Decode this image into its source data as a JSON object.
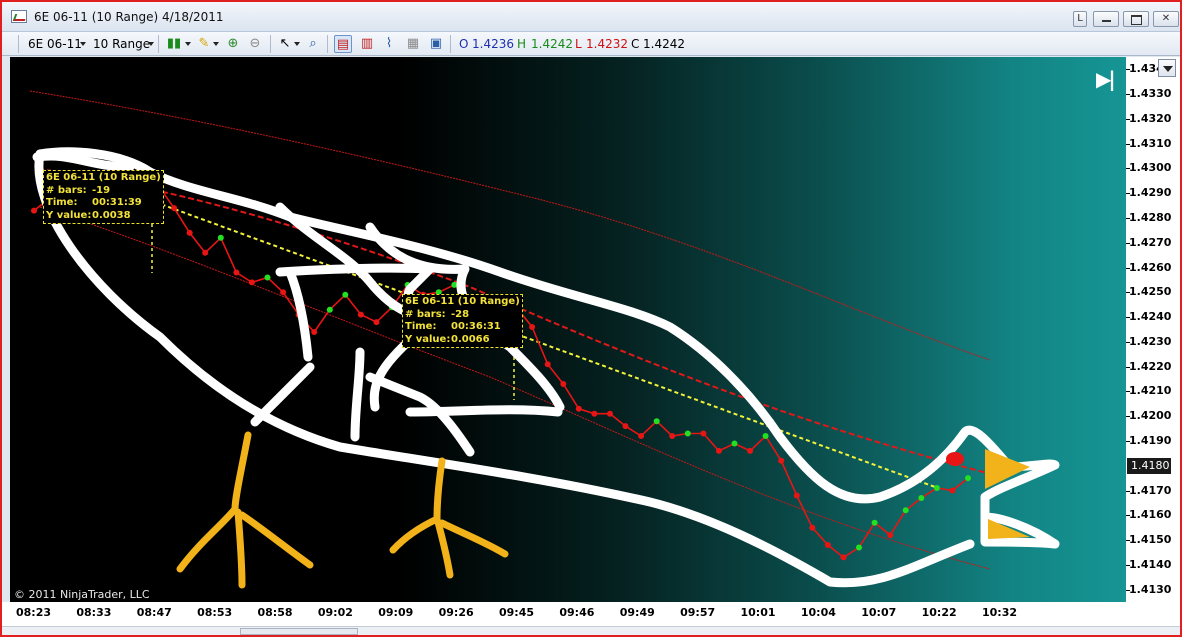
{
  "window": {
    "title": "6E 06-11 (10 Range)  4/18/2011",
    "link_button_label": "L"
  },
  "toolbar": {
    "instrument": "6E 06-11",
    "interval": "10 Range",
    "ohlc": {
      "o_label": "O",
      "o_value": "1.4236",
      "h_label": "H",
      "h_value": "1.4242",
      "l_label": "L",
      "l_value": "1.4232",
      "c_label": "C",
      "c_value": "1.4242"
    },
    "colors": {
      "open": "#1d2fb0",
      "high": "#1a8a1a",
      "low": "#d01010",
      "close": "#000000"
    }
  },
  "price_axis": {
    "ticks": [
      "1.4340",
      "1.4330",
      "1.4320",
      "1.4310",
      "1.4300",
      "1.4290",
      "1.4280",
      "1.4270",
      "1.4260",
      "1.4250",
      "1.4240",
      "1.4230",
      "1.4220",
      "1.4210",
      "1.4200",
      "1.4190",
      "1.4170",
      "1.4160",
      "1.4150",
      "1.4140",
      "1.4130"
    ],
    "last_price": "1.4180"
  },
  "time_axis": {
    "ticks": [
      "08:23",
      "08:33",
      "08:47",
      "08:53",
      "08:58",
      "09:02",
      "09:09",
      "09:26",
      "09:45",
      "09:46",
      "09:49",
      "09:57",
      "10:01",
      "10:04",
      "10:07",
      "10:22",
      "10:32"
    ]
  },
  "chart": {
    "copyright": "© 2011 NinjaTrader, LLC",
    "goto_end_glyph": "▶|",
    "colors": {
      "bar_line": "#e81515",
      "up_dot": "#22e022",
      "down_dot": "#e81515",
      "measure_line": "#f2f23a",
      "doodle_white": "#ffffff",
      "doodle_feet": "#f2b21a",
      "doodle_eye": "#e81515"
    }
  },
  "chart_data": {
    "type": "line",
    "instrument": "6E 06-11 (10 Range)",
    "closes": [
      1.4283,
      1.4288,
      1.4293,
      1.429,
      1.4286,
      1.4292,
      1.4297,
      1.4301,
      1.4293,
      1.4284,
      1.4274,
      1.4266,
      1.4272,
      1.4258,
      1.4254,
      1.4256,
      1.425,
      1.4241,
      1.4234,
      1.4243,
      1.4249,
      1.4241,
      1.4238,
      1.4244,
      1.4253,
      1.4249,
      1.425,
      1.4253,
      1.4248,
      1.4239,
      1.4233,
      1.4244,
      1.4236,
      1.4221,
      1.4213,
      1.4203,
      1.4201,
      1.4201,
      1.4196,
      1.4192,
      1.4198,
      1.4192,
      1.4193,
      1.4193,
      1.4186,
      1.4189,
      1.4186,
      1.4192,
      1.4182,
      1.4168,
      1.4155,
      1.4148,
      1.4143,
      1.4147,
      1.4157,
      1.4152,
      1.4162,
      1.4167,
      1.4171,
      1.417,
      1.4175
    ],
    "ylim": [
      1.4125,
      1.4345
    ],
    "measurements": [
      {
        "title": "6E 06-11 (10 Range)",
        "bars_label": "# bars:",
        "bars": "-19",
        "time_label": "Time:",
        "time": "00:31:39",
        "y_label": "Y value:",
        "y": "0.0038"
      },
      {
        "title": "6E 06-11 (10 Range)",
        "bars_label": "# bars:",
        "bars": "-28",
        "time_label": "Time:",
        "time": "00:36:31",
        "y_label": "Y value:",
        "y": "0.0066"
      }
    ]
  }
}
